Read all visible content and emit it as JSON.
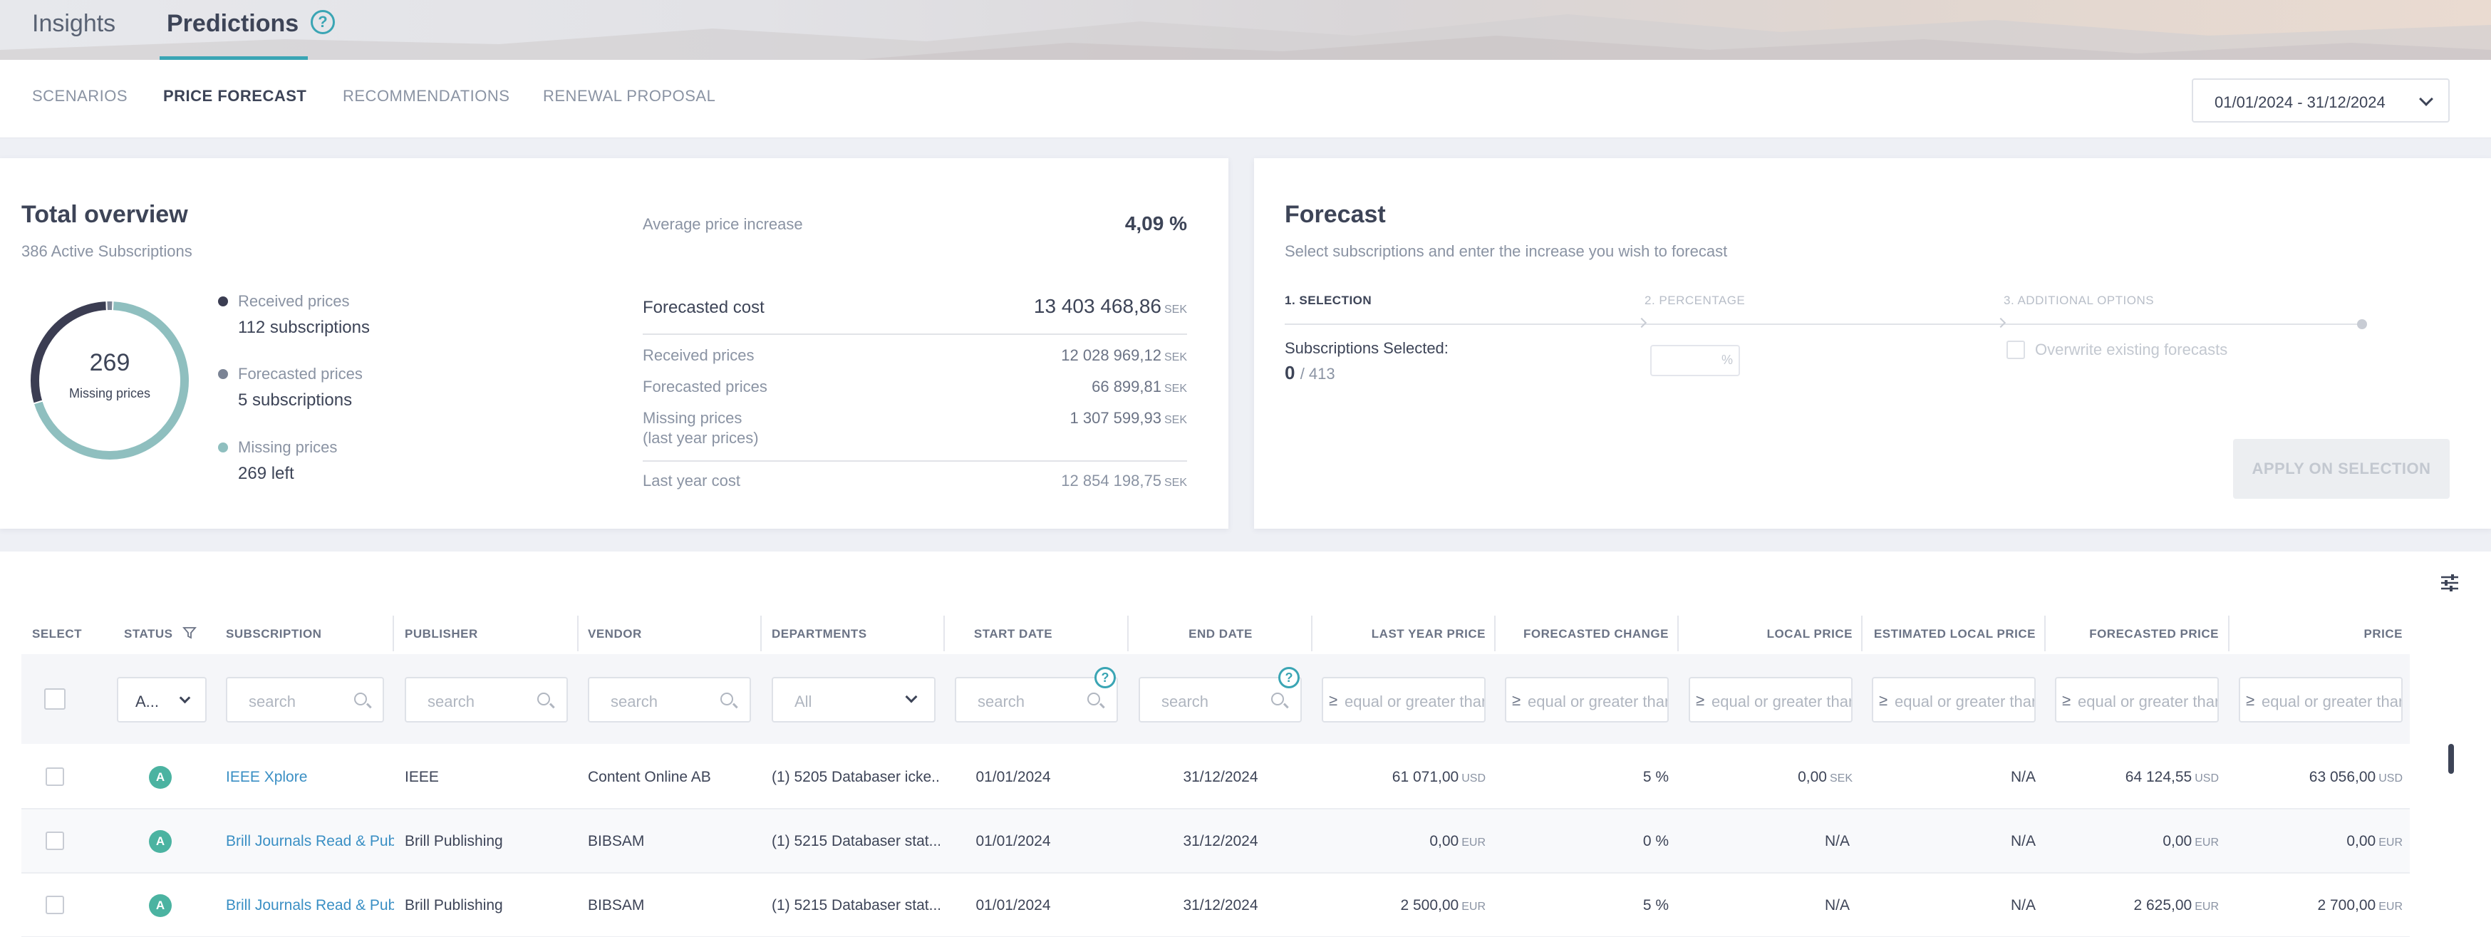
{
  "colors": {
    "accent": "#3aa5b4",
    "dark_ring": "#3b3d52",
    "teal_ring": "#8fbfbf",
    "forecasted_dot": "#7a8394",
    "badge": "#4bb3a1",
    "link": "#3a8fc4"
  },
  "top_tabs": {
    "insights": "Insights",
    "predictions": "Predictions",
    "help": "?"
  },
  "sub_tabs": [
    "SCENARIOS",
    "PRICE FORECAST",
    "RECOMMENDATIONS",
    "RENEWAL PROPOSAL"
  ],
  "date_range": "01/01/2024 - 31/12/2024",
  "overview": {
    "title": "Total overview",
    "subtitle": "386 Active Subscriptions",
    "donut": {
      "center_value": "269",
      "center_label": "Missing prices",
      "segments": [
        {
          "name": "Received prices",
          "value": 112
        },
        {
          "name": "Forecasted prices",
          "value": 5
        },
        {
          "name": "Missing prices",
          "value": 269
        }
      ]
    },
    "legend": [
      {
        "label": "Received prices",
        "value": "112 subscriptions"
      },
      {
        "label": "Forecasted prices",
        "value": "5 subscriptions"
      },
      {
        "label": "Missing prices",
        "value": "269 left"
      }
    ],
    "avg_increase_label": "Average price increase",
    "avg_increase_value": "4,09 %",
    "forecasted_cost_label": "Forecasted cost",
    "forecasted_cost_value": "13 403 468,86",
    "currency": "SEK",
    "breakdown": [
      {
        "label": "Received prices",
        "value": "12 028 969,12"
      },
      {
        "label": "Forecasted prices",
        "value": "66 899,81"
      },
      {
        "label": "Missing prices",
        "label2": "(last year prices)",
        "value": "1 307 599,93"
      }
    ],
    "last_year_label": "Last year cost",
    "last_year_value": "12 854 198,75"
  },
  "forecast": {
    "title": "Forecast",
    "subtitle": "Select subscriptions and enter the increase you wish to forecast",
    "steps": [
      "1. SELECTION",
      "2. PERCENTAGE",
      "3. ADDITIONAL OPTIONS"
    ],
    "selected_label": "Subscriptions Selected:",
    "selected_count": "0",
    "selected_total": "/ 413",
    "percent_symbol": "%",
    "overwrite_label": "Overwrite existing forecasts",
    "apply_label": "APPLY ON SELECTION"
  },
  "table": {
    "headers": [
      "SELECT",
      "STATUS",
      "SUBSCRIPTION",
      "PUBLISHER",
      "VENDOR",
      "DEPARTMENTS",
      "START DATE",
      "END DATE",
      "LAST YEAR PRICE",
      "FORECASTED CHANGE",
      "LOCAL PRICE",
      "ESTIMATED LOCAL PRICE",
      "FORECASTED PRICE",
      "PRICE"
    ],
    "filters": {
      "status": "A...",
      "search": "search",
      "departments": "All",
      "numeric": "equal or greater than"
    },
    "rows": [
      {
        "status": "A",
        "subscription": "IEEE Xplore",
        "publisher": "IEEE",
        "vendor": "Content Online AB",
        "departments": "(1) 5205 Databaser icke...",
        "start": "01/01/2024",
        "end": "31/12/2024",
        "last_year": "61 071,00",
        "last_year_cur": "USD",
        "change": "5 %",
        "local": "0,00",
        "local_cur": "SEK",
        "est_local": "N/A",
        "forecasted": "64 124,55",
        "forecasted_cur": "USD",
        "price": "63 056,00",
        "price_cur": "USD"
      },
      {
        "status": "A",
        "subscription": "Brill Journals Read & Publish",
        "publisher": "Brill Publishing",
        "vendor": "BIBSAM",
        "departments": "(1) 5215 Databaser stat...",
        "start": "01/01/2024",
        "end": "31/12/2024",
        "last_year": "0,00",
        "last_year_cur": "EUR",
        "change": "0 %",
        "local": "N/A",
        "local_cur": "",
        "est_local": "N/A",
        "forecasted": "0,00",
        "forecasted_cur": "EUR",
        "price": "0,00",
        "price_cur": "EUR"
      },
      {
        "status": "A",
        "subscription": "Brill Journals Read & Publish",
        "publisher": "Brill Publishing",
        "vendor": "BIBSAM",
        "departments": "(1) 5215 Databaser stat...",
        "start": "01/01/2024",
        "end": "31/12/2024",
        "last_year": "2 500,00",
        "last_year_cur": "EUR",
        "change": "5 %",
        "local": "N/A",
        "local_cur": "",
        "est_local": "N/A",
        "forecasted": "2 625,00",
        "forecasted_cur": "EUR",
        "price": "2 700,00",
        "price_cur": "EUR"
      }
    ]
  }
}
